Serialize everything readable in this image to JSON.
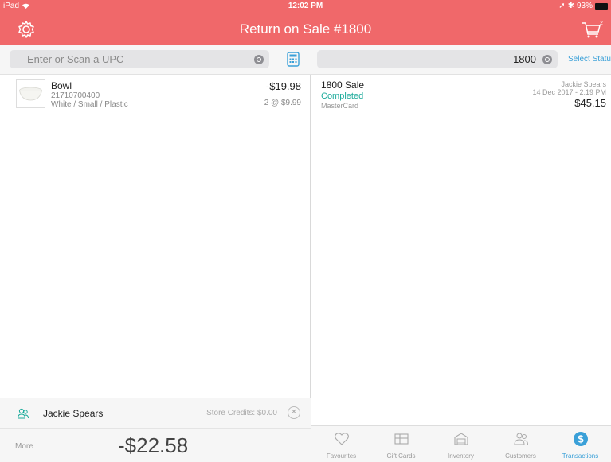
{
  "status_bar": {
    "device": "iPad",
    "time": "12:02 PM",
    "battery": "93%"
  },
  "navbar": {
    "title": "Return on Sale #1800",
    "cart_count": "2"
  },
  "left": {
    "search_placeholder": "Enter or Scan a UPC",
    "items": [
      {
        "name": "Bowl",
        "upc": "21710700400",
        "variant": "White / Small / Plastic",
        "price": "-$19.98",
        "qty": "2 @ $9.99"
      }
    ],
    "customer": {
      "name": "Jackie Spears",
      "store_credits": "Store Credits: $0.00"
    },
    "more_label": "More",
    "total": "-$22.58"
  },
  "right": {
    "search_value": "1800",
    "select_status": "Select Status",
    "transactions": [
      {
        "title": "1800 Sale",
        "status": "Completed",
        "method": "MasterCard",
        "customer": "Jackie Spears",
        "date": "14 Dec 2017 - 2:19 PM",
        "amount": "$45.15"
      }
    ]
  },
  "tabs": [
    {
      "label": "Favourites",
      "icon": "heart-icon",
      "active": false
    },
    {
      "label": "Gift Cards",
      "icon": "gift-card-icon",
      "active": false
    },
    {
      "label": "Inventory",
      "icon": "warehouse-icon",
      "active": false
    },
    {
      "label": "Customers",
      "icon": "customers-icon",
      "active": false
    },
    {
      "label": "Transactions",
      "icon": "dollar-icon",
      "active": true
    }
  ],
  "colors": {
    "header": "#f0686a",
    "accent": "#3aa0d8",
    "completed": "#1aaa9a"
  }
}
